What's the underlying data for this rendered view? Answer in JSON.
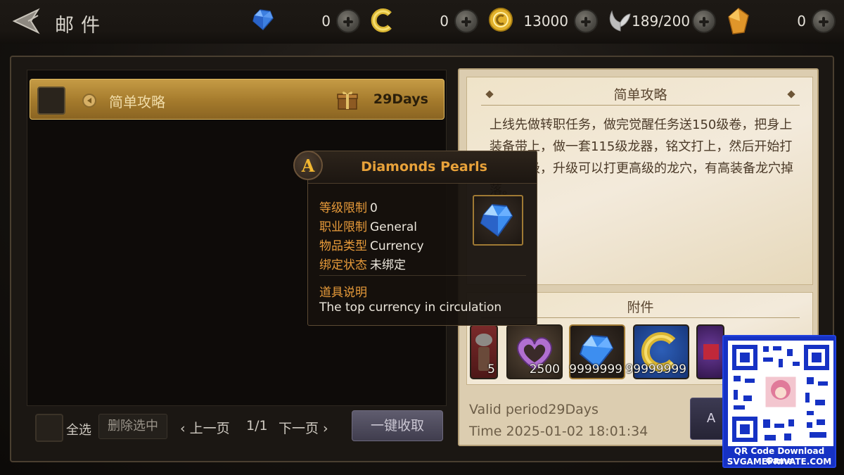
{
  "header": {
    "title": "邮件",
    "resources": [
      {
        "name": "diamond",
        "value": "0"
      },
      {
        "name": "c-coin",
        "value": "0"
      },
      {
        "name": "gold",
        "value": "13000"
      },
      {
        "name": "stamina",
        "value": "189/200"
      },
      {
        "name": "crystal",
        "value": "0"
      }
    ]
  },
  "mail_list": {
    "items": [
      {
        "title": "简单攻略",
        "expire": "29Days"
      }
    ],
    "select_all_label": "全选",
    "delete_selected_label": "删除选中",
    "prev_page_label": "上一页",
    "page_indicator": "1/1",
    "next_page_label": "下一页",
    "collect_all_label": "一键收取"
  },
  "mail_detail": {
    "title": "简单攻略",
    "body": "上线先做转职任务，做完觉醒任务送150级卷，把身上装备带上，做一套115级龙器，铭文打上，然后开始打龙穴升级，升级可以打更高级的龙穴，有高装备龙穴掉落。",
    "attachments_label": "附件",
    "attachments": [
      {
        "name": "item-1",
        "count": "5"
      },
      {
        "name": "heart-box",
        "count": "2500"
      },
      {
        "name": "diamond",
        "count": "9999999"
      },
      {
        "name": "c-coin",
        "count": "99999999"
      },
      {
        "name": "item-5",
        "count": ""
      },
      {
        "name": "item-6",
        "count": ""
      }
    ],
    "valid_period": "Valid period29Days",
    "time": "Time 2025-01-02 18:01:34",
    "action_label": "A"
  },
  "tooltip": {
    "grade": "A",
    "title": "Diamonds Pearls",
    "rows": [
      {
        "label": "等级限制",
        "value": "0"
      },
      {
        "label": "职业限制",
        "value": "General"
      },
      {
        "label": "物品类型",
        "value": "Currency"
      },
      {
        "label": "绑定状态",
        "value": "未绑定"
      }
    ],
    "desc_label": "道具说明",
    "desc": "The top currency in circulation"
  },
  "watermark": {
    "caption1": "QR Code Download Game",
    "caption2": "SVGAMEPRIVATE.COM"
  },
  "colors": {
    "accent_orange": "#e89b3a",
    "gold_row": "#c59b45",
    "parchment": "#efe3c8",
    "qr_blue": "#1632c4"
  }
}
